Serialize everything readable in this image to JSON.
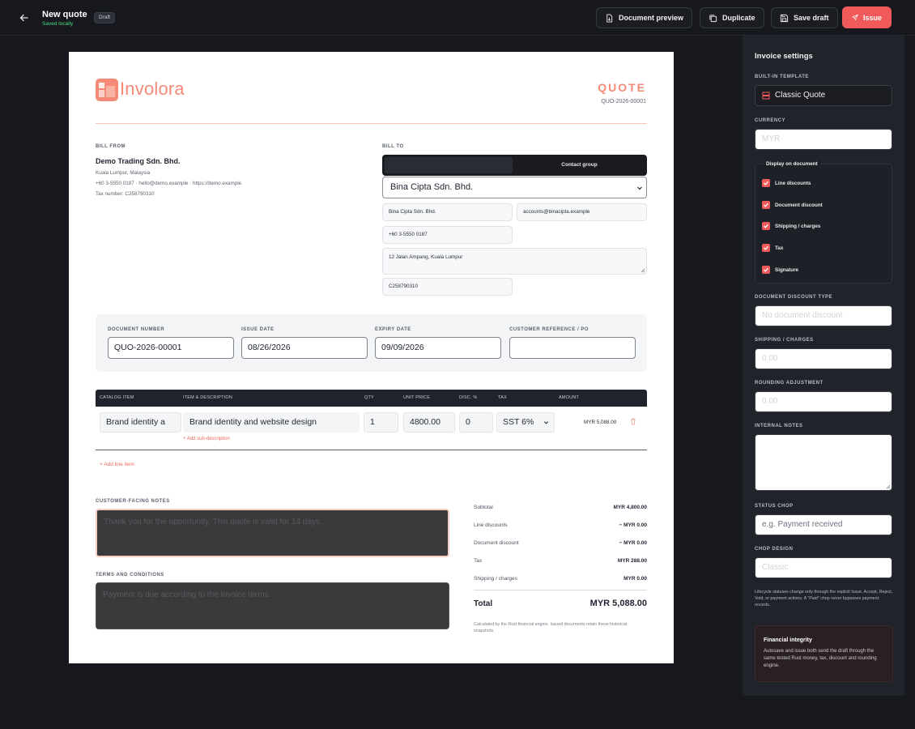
{
  "header": {
    "title": "New quote",
    "save_status": "Saved locally",
    "status_badge": "Draft",
    "actions": {
      "preview": "Document preview",
      "duplicate": "Duplicate",
      "save_draft": "Save draft",
      "issue": "Issue"
    }
  },
  "document": {
    "brand": "Involora",
    "type": "QUOTE",
    "number": "QUO-2026-00001",
    "bill_from": {
      "label": "BILL FROM",
      "name": "Demo Trading Sdn. Bhd.",
      "address": "Kuala Lumpur, Malaysia",
      "contact": "+60 3-5550 0187 · hello@demo.example · https://demo.example",
      "tax": "Tax number: C258790310"
    },
    "bill_to": {
      "label": "BILL TO",
      "toggle_second": "Contact group",
      "selected_client": "Bina Cipta Sdn. Bhd.",
      "name": "Bina Cipta Sdn. Bhd.",
      "email": "accounts@binacipta.example",
      "phone": "+60 3-5550 0187",
      "address": "12 Jalan Ampang, Kuala Lumpur",
      "tax": "C258790310"
    },
    "meta": {
      "doc_number_label": "DOCUMENT NUMBER",
      "doc_number": "QUO-2026-00001",
      "issue_label": "ISSUE DATE",
      "issue_date": "08/26/2026",
      "expiry_label": "EXPIRY DATE",
      "expiry_date": "09/09/2026",
      "ref_label": "CUSTOMER REFERENCE / PO",
      "ref_value": ""
    },
    "line_items": {
      "headers": [
        "CATALOG ITEM",
        "ITEM & DESCRIPTION",
        "QTY",
        "UNIT PRICE",
        "DISC. %",
        "TAX",
        "AMOUNT"
      ],
      "rows": [
        {
          "catalog": "Brand identity a",
          "description": "Brand identity and website design",
          "qty": "1",
          "unit_price": "4800.00",
          "discount": "0",
          "tax": "SST 6%",
          "amount": "MYR 5,088.00"
        }
      ],
      "add_sub": "+ Add sub-description",
      "add_line": "+ Add line item"
    },
    "notes": {
      "customer_label": "CUSTOMER-FACING NOTES",
      "customer_text": "Thank you for the opportunity. This quote is valid for 14 days.",
      "terms_label": "TERMS AND CONDITIONS",
      "terms_text": "Payment is due according to the invoice terms."
    },
    "totals": {
      "subtotal_label": "Subtotal",
      "subtotal": "MYR 4,800.00",
      "line_disc_label": "Line discounts",
      "line_disc": "− MYR 0.00",
      "doc_disc_label": "Document discount",
      "doc_disc": "− MYR 0.00",
      "tax_label": "Tax",
      "tax": "MYR 288.00",
      "shipping_label": "Shipping / charges",
      "shipping": "MYR 0.00",
      "total_label": "Total",
      "total": "MYR 5,088.00",
      "footnote": "Calculated by the Rust financial engine. Issued documents retain these historical snapshots."
    }
  },
  "settings": {
    "title": "Invoice settings",
    "template_label": "BUILT-IN TEMPLATE",
    "template_value": "Classic Quote",
    "currency_label": "CURRENCY",
    "currency_value": "MYR",
    "display_title": "Display on document",
    "display_options": [
      "Line discounts",
      "Document discount",
      "Shipping / charges",
      "Tax",
      "Signature"
    ],
    "discount_type_label": "DOCUMENT DISCOUNT TYPE",
    "discount_type_value": "No document discount",
    "shipping_label": "SHIPPING / CHARGES",
    "shipping_value": "0.00",
    "rounding_label": "ROUNDING ADJUSTMENT",
    "rounding_value": "0.00",
    "internal_notes_label": "INTERNAL NOTES",
    "status_chop_label": "STATUS CHOP",
    "status_chop_placeholder": "e.g. Payment received",
    "chop_design_label": "CHOP DESIGN",
    "chop_design_value": "Classic",
    "lifecycle_note": "Lifecycle statuses change only through the explicit Issue, Accept, Reject, Void, or payment actions. A \"Paid\" chop never bypasses payment records.",
    "integrity_title": "Financial integrity",
    "integrity_text": "Autosave and issue both send the draft through the same tested Rust money, tax, discount and rounding engine."
  },
  "colors": {
    "accent": "#f05a5a",
    "brand": "#f58a76",
    "background": "#16181d",
    "panel": "#20232a"
  }
}
